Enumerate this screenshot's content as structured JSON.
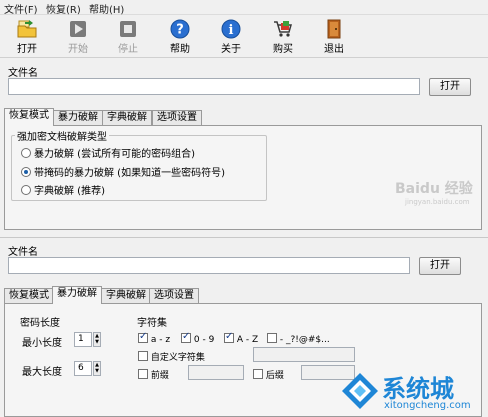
{
  "menu": [
    "文件(F)",
    "恢复(R)",
    "帮助(H)"
  ],
  "toolbar": [
    {
      "label": "打开",
      "icon": "open-folder-icon",
      "enabled": true
    },
    {
      "label": "开始",
      "icon": "play-icon",
      "enabled": false
    },
    {
      "label": "停止",
      "icon": "stop-icon",
      "enabled": false
    },
    {
      "label": "帮助",
      "icon": "help-icon",
      "enabled": true
    },
    {
      "label": "关于",
      "icon": "info-icon",
      "enabled": true
    },
    {
      "label": "购买",
      "icon": "cart-icon",
      "enabled": true
    },
    {
      "label": "退出",
      "icon": "exit-door-icon",
      "enabled": true
    }
  ],
  "top": {
    "file_label": "文件名",
    "file_value": "",
    "open_button": "打开",
    "tabs": [
      "恢复模式",
      "暴力破解",
      "字典破解",
      "选项设置"
    ],
    "active_tab": 0,
    "group_title": "强加密文档破解类型",
    "options": [
      {
        "label": "暴力破解 (尝试所有可能的密码组合)",
        "selected": false
      },
      {
        "label": "带掩码的暴力破解 (如果知道一些密码符号)",
        "selected": true
      },
      {
        "label": "字典破解 (推荐)",
        "selected": false
      }
    ]
  },
  "bottom": {
    "file_label": "文件名",
    "file_value": "",
    "open_button": "打开",
    "tabs": [
      "恢复模式",
      "暴力破解",
      "字典破解",
      "选项设置"
    ],
    "active_tab": 1,
    "length_title": "密码长度",
    "min_label": "最小长度",
    "min_value": "1",
    "max_label": "最大长度",
    "max_value": "6",
    "charset_title": "字符集",
    "charsets": [
      {
        "label": "a - z",
        "checked": true
      },
      {
        "label": "0 - 9",
        "checked": true
      },
      {
        "label": "A - Z",
        "checked": true
      },
      {
        "label": "- _?!@#$...",
        "checked": false
      }
    ],
    "custom_label": "自定义字符集",
    "prefix_label": "前缀",
    "suffix_label": "后缀"
  },
  "watermarks": {
    "baidu": "Baidu 经验",
    "baidu_sub": "jingyan.baidu.com",
    "site_name": "系统城",
    "site_url": "xitongcheng.com"
  }
}
